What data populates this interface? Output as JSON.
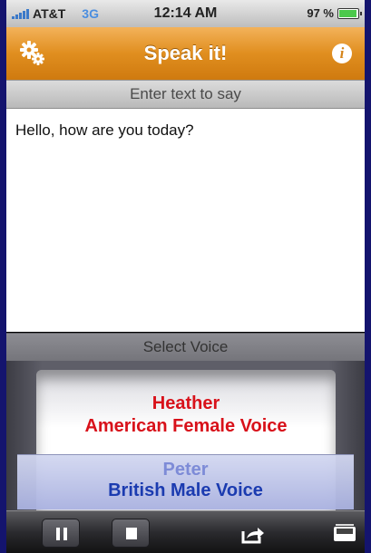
{
  "status_bar": {
    "carrier": "AT&T",
    "network": "3G",
    "time": "12:14 AM",
    "battery": "97 %",
    "battery_level": 0.97
  },
  "title_bar": {
    "title": "Speak it!",
    "settings_icon": "gear-icon",
    "info_icon": "info-icon",
    "info_glyph": "i"
  },
  "text_section": {
    "header": "Enter text to say",
    "value": "Hello, how are you today?"
  },
  "voice_section": {
    "header": "Select Voice",
    "selected": {
      "name": "Heather",
      "desc": "American Female Voice"
    },
    "next": {
      "name": "Peter",
      "desc": "British Male Voice"
    }
  },
  "toolbar": {
    "icons": [
      "pause-icon",
      "stop-icon",
      "share-icon",
      "archive-icon"
    ]
  },
  "colors": {
    "title_orange": "#e08e1f",
    "selected_voice": "#d8111a",
    "next_voice": "#1b3bb0"
  }
}
